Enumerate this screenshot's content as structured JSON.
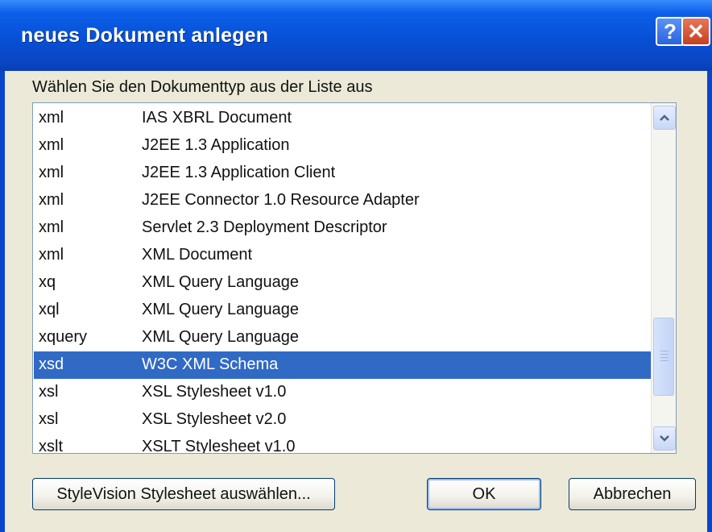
{
  "window": {
    "title": "neues Dokument anlegen"
  },
  "titlebar_buttons": {
    "help": "?",
    "close": "✕"
  },
  "list_label": "Wählen Sie den Dokumenttyp aus der Liste aus",
  "list": {
    "rows": [
      {
        "ext": "xml",
        "desc": "IAS XBRL Document"
      },
      {
        "ext": "xml",
        "desc": "J2EE 1.3 Application"
      },
      {
        "ext": "xml",
        "desc": "J2EE 1.3 Application Client"
      },
      {
        "ext": "xml",
        "desc": "J2EE Connector 1.0 Resource Adapter"
      },
      {
        "ext": "xml",
        "desc": "Servlet 2.3 Deployment Descriptor"
      },
      {
        "ext": "xml",
        "desc": "XML Document"
      },
      {
        "ext": "xq",
        "desc": "XML Query Language"
      },
      {
        "ext": "xql",
        "desc": "XML Query Language"
      },
      {
        "ext": "xquery",
        "desc": "XML Query Language"
      },
      {
        "ext": "xsd",
        "desc": "W3C XML Schema",
        "selected": true
      },
      {
        "ext": "xsl",
        "desc": "XSL Stylesheet v1.0"
      },
      {
        "ext": "xsl",
        "desc": "XSL Stylesheet v2.0"
      },
      {
        "ext": "xslt",
        "desc": "XSLT Stylesheet v1.0"
      }
    ]
  },
  "buttons": {
    "stylevision": "StyleVision Stylesheet auswählen...",
    "ok": "OK",
    "cancel": "Abbrechen"
  },
  "colors": {
    "titlebar": "#0a47c6",
    "selection": "#316ac5",
    "dialog_bg": "#ece9d8"
  }
}
